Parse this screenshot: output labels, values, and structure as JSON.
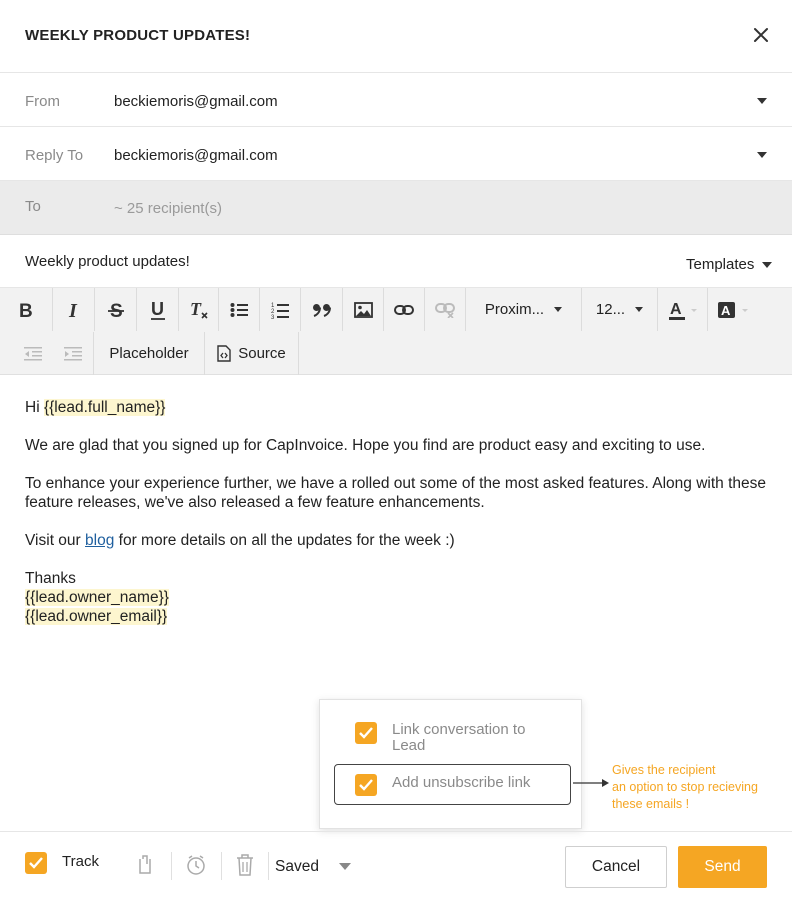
{
  "header": {
    "title": "WEEKLY PRODUCT UPDATES!",
    "close_icon": "close-icon"
  },
  "fields": {
    "from": {
      "label": "From",
      "value": "beckiemoris@gmail.com"
    },
    "reply_to": {
      "label": "Reply To",
      "value": "beckiemoris@gmail.com"
    },
    "to": {
      "label": "To",
      "value": "~ 25 recipient(s)"
    },
    "subject": {
      "value": "Weekly product updates!"
    },
    "templates_label": "Templates"
  },
  "toolbar": {
    "icons": [
      "bold-icon",
      "italic-icon",
      "strikethrough-icon",
      "underline-icon",
      "clear-format-icon",
      "bullet-list-icon",
      "numbered-list-icon",
      "quote-icon",
      "image-icon",
      "link-icon",
      "unlink-icon",
      "text-color-icon",
      "background-color-icon",
      "outdent-icon",
      "indent-icon",
      "source-icon"
    ],
    "font_family": "Proxim...",
    "font_size": "12...",
    "placeholder_label": "Placeholder",
    "source_label": "Source"
  },
  "body": {
    "greeting": "Hi ",
    "greeting_placeholder": "{{lead.full_name}}",
    "para1": "We are glad that you signed up for CapInvoice. Hope you find are product easy and exciting to use.",
    "para2": "To enhance your experience further, we have a rolled out some of the most asked features. Along with these feature releases, we've also released a few feature enhancements.",
    "para3_before": "Visit our ",
    "para3_link": "blog",
    "para3_after": " for more details on all the updates for the week :)",
    "thanks": "Thanks",
    "owner_name": "{{lead.owner_name}}",
    "owner_email": "{{lead.owner_email}}"
  },
  "popup": {
    "option1": {
      "label": "Link conversation to Lead",
      "checked": true
    },
    "option2": {
      "label": "Add unsubscribe link",
      "checked": true
    }
  },
  "annotation": {
    "line1": "Gives the recipient",
    "line2": "an option to stop recieving",
    "line3": "these emails !"
  },
  "footer": {
    "track_label": "Track",
    "track_checked": true,
    "icons": [
      "attachment-icon",
      "schedule-icon",
      "delete-icon"
    ],
    "status": "Saved",
    "cancel_label": "Cancel",
    "send_label": "Send"
  },
  "colors": {
    "accent": "#f5a623",
    "link": "#1f5f9e",
    "placeholder_bg": "#fdf6cf"
  }
}
